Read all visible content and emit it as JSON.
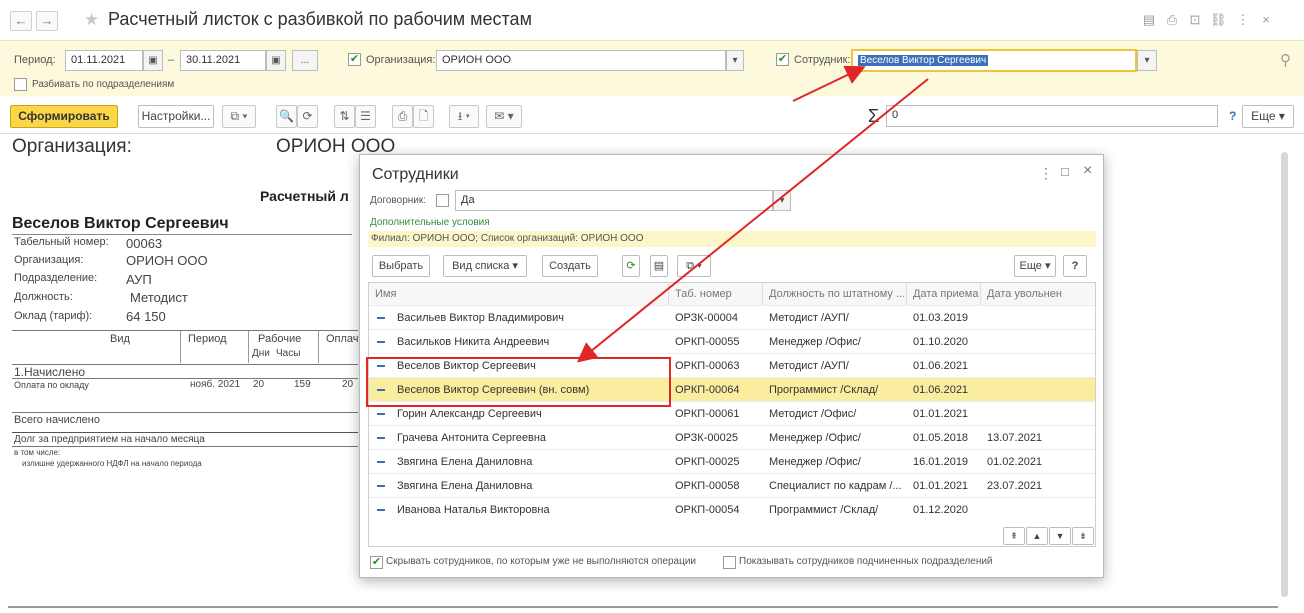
{
  "window": {
    "title": "Расчетный листок с разбивкой по рабочим местам",
    "back_glyph": "←",
    "forward_glyph": "→",
    "star_glyph": "★",
    "toolbar_glyphs": [
      "▤",
      "⎙",
      "⊡",
      "⛓",
      "⋮",
      "×"
    ]
  },
  "params": {
    "period_label": "Период:",
    "period_from": "01.11.2021",
    "period_dash": "–",
    "period_to": "30.11.2021",
    "calendar_glyph": "▣",
    "ellipsis_glyph": "...",
    "org_label": "Организация:",
    "org_value": "ОРИОН ООО",
    "employee_label": "Сотрудник:",
    "employee_value": "Веселов Виктор Сергеевич",
    "split_label": "Разбивать по подразделениям",
    "pin_glyph": "⚲",
    "check_glyph": "✔"
  },
  "toolbar": {
    "form_button": "Сформировать",
    "settings_button": "Настройки...",
    "copy_glyph": "⧉ ▾",
    "find_glyph": "🔍",
    "find_next_glyph": "⟳",
    "sort_glyph": "⇅",
    "sort2_glyph": "☰",
    "print_glyph": "⎙",
    "preview_glyph": "🗋",
    "save_glyph": "⭳ ▾",
    "mail_glyph": "✉ ▾",
    "sigma": "Σ",
    "sum_value": "0",
    "help": "?",
    "more_button": "Еще ▾"
  },
  "report": {
    "org_label": "Организация:",
    "org_value": "ОРИОН ООО",
    "doc_title": "Расчетный л",
    "employee_name": "Веселов Виктор Сергеевич",
    "fields": [
      {
        "label": "Табельный номер:",
        "value": "00063"
      },
      {
        "label": "Организация:",
        "value": "ОРИОН ООО"
      },
      {
        "label": "Подразделение:",
        "value": "АУП"
      },
      {
        "label": "Должность:",
        "value": "Методист"
      },
      {
        "label": "Оклад (тариф):",
        "value": "64 150"
      }
    ],
    "col_vid": "Вид",
    "col_period": "Период",
    "col_work": "Рабочие",
    "col_days": "Дни",
    "col_hours": "Часы",
    "col_pay": "Оплач",
    "section_accrued": "1.Начислено",
    "row_label": "Оплата по окладу",
    "row_period": "нояб. 2021",
    "row_days": "20",
    "row_hours": "159",
    "row_pay": "20",
    "total_accrued": "Всего начислено",
    "debt_label": "Долг за предприятием на начало месяца",
    "including": "в том числе:",
    "overpaid_ndfl": "излишне удержанного НДФЛ на начало периода"
  },
  "dialog": {
    "title": "Сотрудники",
    "menu_glyph": "⋮",
    "max_glyph": "□",
    "close_glyph": "×",
    "contractor_label": "Договорник:",
    "contractor_value": "Да",
    "dropdown_glyph": "▾",
    "additional_label": "Дополнительные условия",
    "filter_text": "Филиал: ОРИОН ООО; Список организаций: ОРИОН ООО",
    "select_button": "Выбрать",
    "view_button": "Вид списка ▾",
    "create_button": "Создать",
    "refresh_glyph": "⟳",
    "list_glyph": "▤",
    "more_icon_glyph": "⧉ ▾",
    "more_button": "Еще ▾",
    "help_button": "?",
    "columns": [
      "Имя",
      "Таб. номер",
      "Должность по штатному ...",
      "Дата приема",
      "Дата увольнен"
    ],
    "rows": [
      {
        "name": "Васильев Виктор Владимирович",
        "tab": "ОРЗК-00004",
        "position": "Методист /АУП/",
        "hired": "01.03.2019",
        "fired": ""
      },
      {
        "name": "Васильков Никита Андреевич",
        "tab": "ОРКП-00055",
        "position": "Менеджер /Офис/",
        "hired": "01.10.2020",
        "fired": ""
      },
      {
        "name": "Веселов Виктор Сергеевич",
        "tab": "ОРКП-00063",
        "position": "Методист /АУП/",
        "hired": "01.06.2021",
        "fired": ""
      },
      {
        "name": "Веселов Виктор Сергеевич (вн. совм)",
        "tab": "ОРКП-00064",
        "position": "Программист /Склад/",
        "hired": "01.06.2021",
        "fired": ""
      },
      {
        "name": "Горин Александр Сергеевич",
        "tab": "ОРКП-00061",
        "position": "Методист /Офис/",
        "hired": "01.01.2021",
        "fired": ""
      },
      {
        "name": "Грачева Антонита Сергеевна",
        "tab": "ОРЗК-00025",
        "position": "Менеджер /Офис/",
        "hired": "01.05.2018",
        "fired": "13.07.2021"
      },
      {
        "name": "Звягина Елена Даниловна",
        "tab": "ОРКП-00025",
        "position": "Менеджер /Офис/",
        "hired": "16.01.2019",
        "fired": "01.02.2021"
      },
      {
        "name": "Звягина Елена Даниловна",
        "tab": "ОРКП-00058",
        "position": "Специалист по кадрам /...",
        "hired": "01.01.2021",
        "fired": "23.07.2021"
      },
      {
        "name": "Иванова Наталья Викторовна",
        "tab": "ОРКП-00054",
        "position": "Программист /Склад/",
        "hired": "01.12.2020",
        "fired": ""
      }
    ],
    "nav_glyphs": [
      "⇞",
      "▲",
      "▼",
      "⇟"
    ],
    "hide_label": "Скрывать сотрудников, по которым уже не выполняются операции",
    "show_sub_label": "Показывать сотрудников подчиненных подразделений",
    "check_glyph": "✔"
  }
}
